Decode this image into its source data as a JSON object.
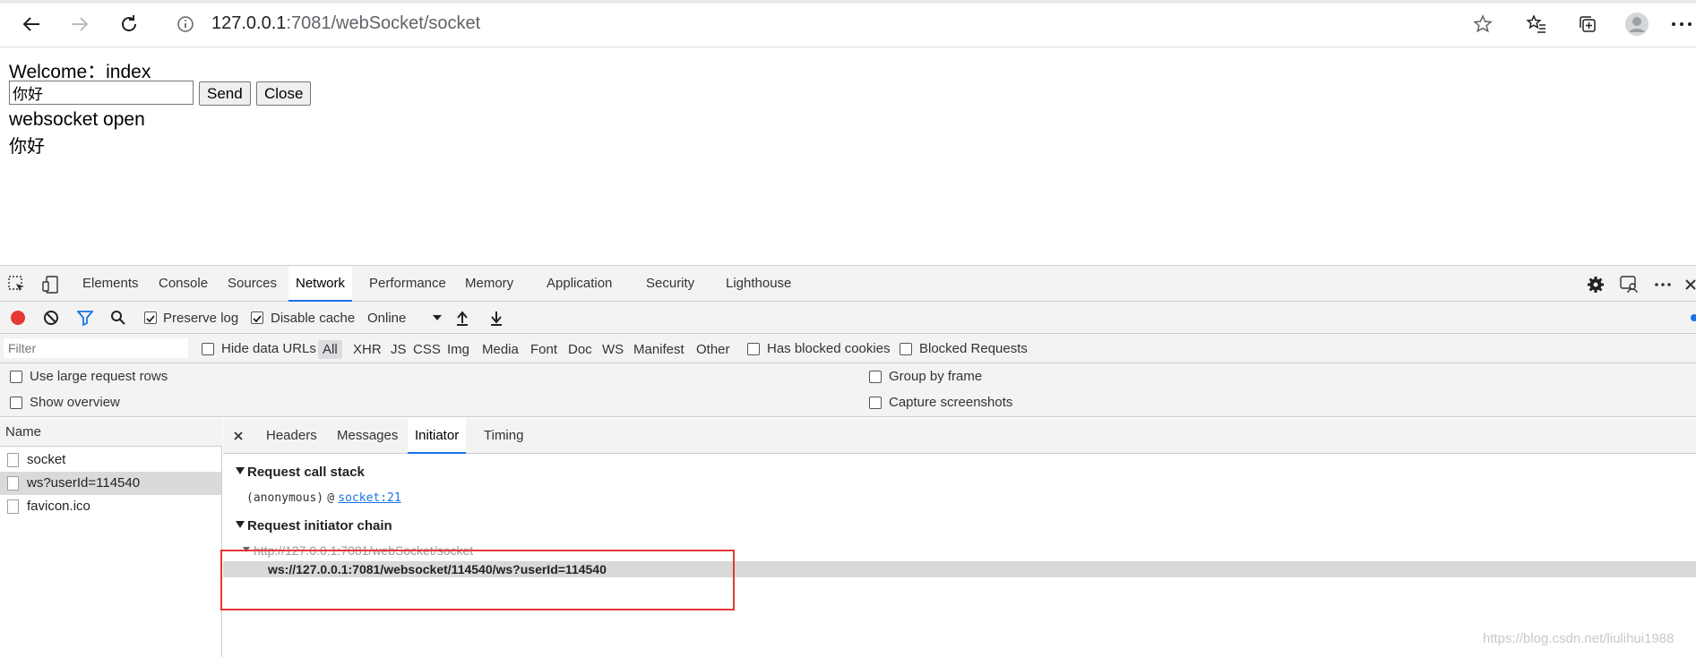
{
  "browser": {
    "url_host": "127.0.0.1",
    "url_rest": ":7081/webSocket/socket"
  },
  "page": {
    "welcome_text": "Welcome：index",
    "input_value": "你好",
    "send_label": "Send",
    "close_label": "Close",
    "status_text": "websocket open",
    "received_text": "你好"
  },
  "devtools": {
    "tabs": [
      "Elements",
      "Console",
      "Sources",
      "Network",
      "Performance",
      "Memory",
      "Application",
      "Security",
      "Lighthouse"
    ],
    "active_tab": "Network",
    "toolbar": {
      "preserve_log": "Preserve log",
      "disable_cache": "Disable cache",
      "throttle": "Online"
    },
    "filter": {
      "placeholder": "Filter",
      "hide_data_urls": "Hide data URLs",
      "types": [
        "All",
        "XHR",
        "JS",
        "CSS",
        "Img",
        "Media",
        "Font",
        "Doc",
        "WS",
        "Manifest",
        "Other"
      ],
      "has_blocked_cookies": "Has blocked cookies",
      "blocked_requests": "Blocked Requests"
    },
    "options": {
      "large_rows": "Use large request rows",
      "show_overview": "Show overview",
      "group_by_frame": "Group by frame",
      "capture_screenshots": "Capture screenshots"
    },
    "requests": {
      "header": "Name",
      "items": [
        "socket",
        "ws?userId=114540",
        "favicon.ico"
      ],
      "selected": "ws?userId=114540"
    },
    "detail": {
      "tabs": [
        "Headers",
        "Messages",
        "Initiator",
        "Timing"
      ],
      "active_tab": "Initiator",
      "call_stack_title": "Request call stack",
      "call_stack_fn": "(anonymous)",
      "call_stack_at": "@",
      "call_stack_link": "socket:21",
      "initiator_chain_title": "Request initiator chain",
      "chain_parent": "http://127.0.0.1:7081/webSocket/socket",
      "chain_child": "ws://127.0.0.1:7081/websocket/114540/ws?userId=114540"
    }
  },
  "watermark": "https://blog.csdn.net/liulihui1988",
  "colors": {
    "accent": "#1a73e8",
    "record_red": "#e53935",
    "highlight_box": "#e53935"
  }
}
